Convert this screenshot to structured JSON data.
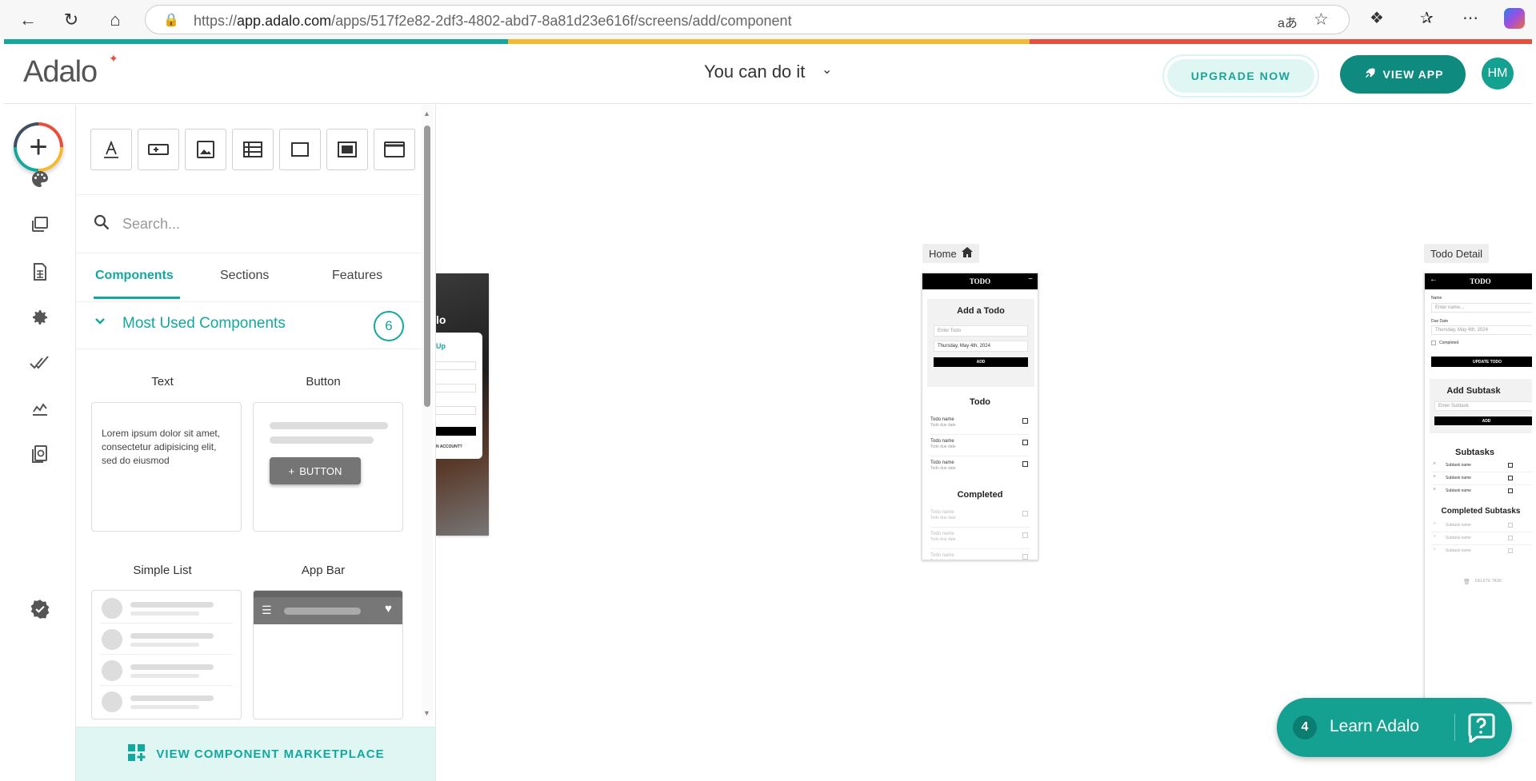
{
  "browser": {
    "url_prefix": "https://",
    "url_domain": "app.adalo.com",
    "url_path": "/apps/517f2e82-2df3-4802-abd7-8a81d23e616f/screens/add/component",
    "read_aloud_glyph": "aあ"
  },
  "header": {
    "logo": "Adalo",
    "app_name": "You can do it",
    "upgrade_label": "UPGRADE NOW",
    "view_app_label": "VIEW APP",
    "avatar_initials": "HM"
  },
  "panel": {
    "search_placeholder": "Search...",
    "tabs": [
      "Components",
      "Sections",
      "Features"
    ],
    "section_title": "Most Used Components",
    "section_count": "6",
    "components": [
      {
        "label": "Text"
      },
      {
        "label": "Button"
      },
      {
        "label": "Simple List"
      },
      {
        "label": "App Bar"
      }
    ],
    "text_preview": "Lorem ipsum dolor sit amet, consectetur adipisicing elit, sed do eiusmod",
    "button_preview": "BUTTON",
    "marketplace_label": "VIEW COMPONENT MARKETPLACE"
  },
  "canvas": {
    "screens": [
      {
        "label": "Home",
        "header": "TODO",
        "card_title": "Add a Todo",
        "input_placeholder": "Enter Todo",
        "date_value": "Thursday, May 4th, 2024",
        "add_button": "ADD",
        "todo_section": "Todo",
        "completed_section": "Completed",
        "row_name": "Todo name",
        "row_date": "Todo due date"
      },
      {
        "label": "Todo Detail",
        "header": "TODO",
        "name_label": "Name",
        "name_placeholder": "Enter name...",
        "due_label": "Due Date",
        "due_value": "Thursday, May 4th, 2024",
        "completed_label": "Completed",
        "update_button": "UPDATE TODO",
        "add_subtask_title": "Add Subtask",
        "subtask_placeholder": "Enter Subtask",
        "add_button": "ADD",
        "subtasks_title": "Subtasks",
        "completed_subtasks_title": "Completed Subtasks",
        "subtask_name": "Subtask name",
        "delete_label": "DELETE TASK"
      }
    ],
    "partial_screen": {
      "title_fragment": "lo",
      "link_fragment": "Up",
      "footer_fragment": "N ACCOUNT?"
    }
  },
  "learn": {
    "badge": "4",
    "label": "Learn Adalo"
  },
  "colors": {
    "accent": "#13a89e",
    "stripe": [
      "#13a89e",
      "#f5b82e",
      "#e94e3c"
    ]
  }
}
